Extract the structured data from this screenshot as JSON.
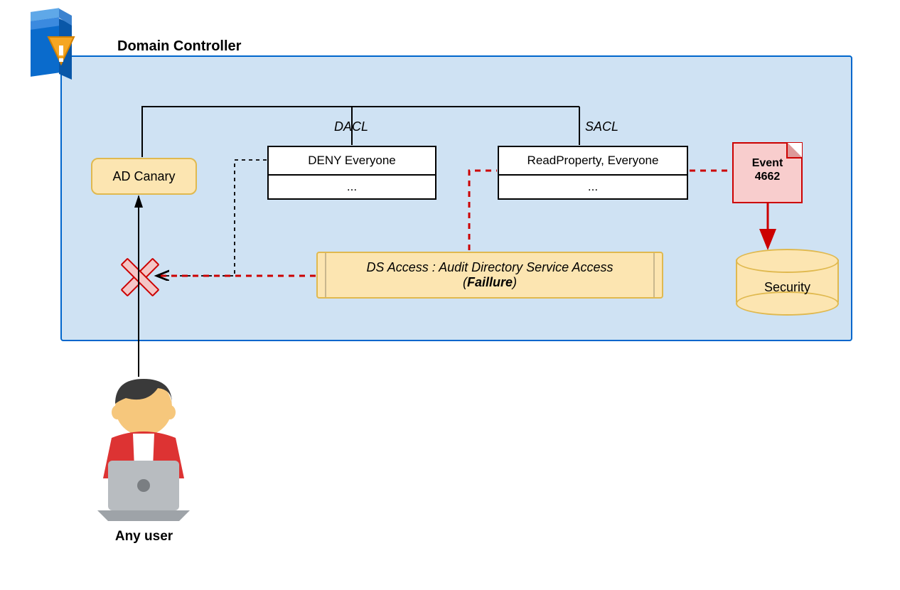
{
  "title": "Domain Controller",
  "ad_canary": "AD Canary",
  "dacl": {
    "label": "DACL",
    "row1": "DENY Everyone",
    "row2": "..."
  },
  "sacl": {
    "label": "SACL",
    "row1": "ReadProperty, Everyone",
    "row2": "..."
  },
  "ds_access": {
    "line1": "DS Access : Audit Directory Service Access",
    "line2_open": "(",
    "line2_bold": "Faillure",
    "line2_close": ")"
  },
  "event": {
    "line1": "Event",
    "line2": "4662"
  },
  "security": "Security",
  "user": "Any user"
}
